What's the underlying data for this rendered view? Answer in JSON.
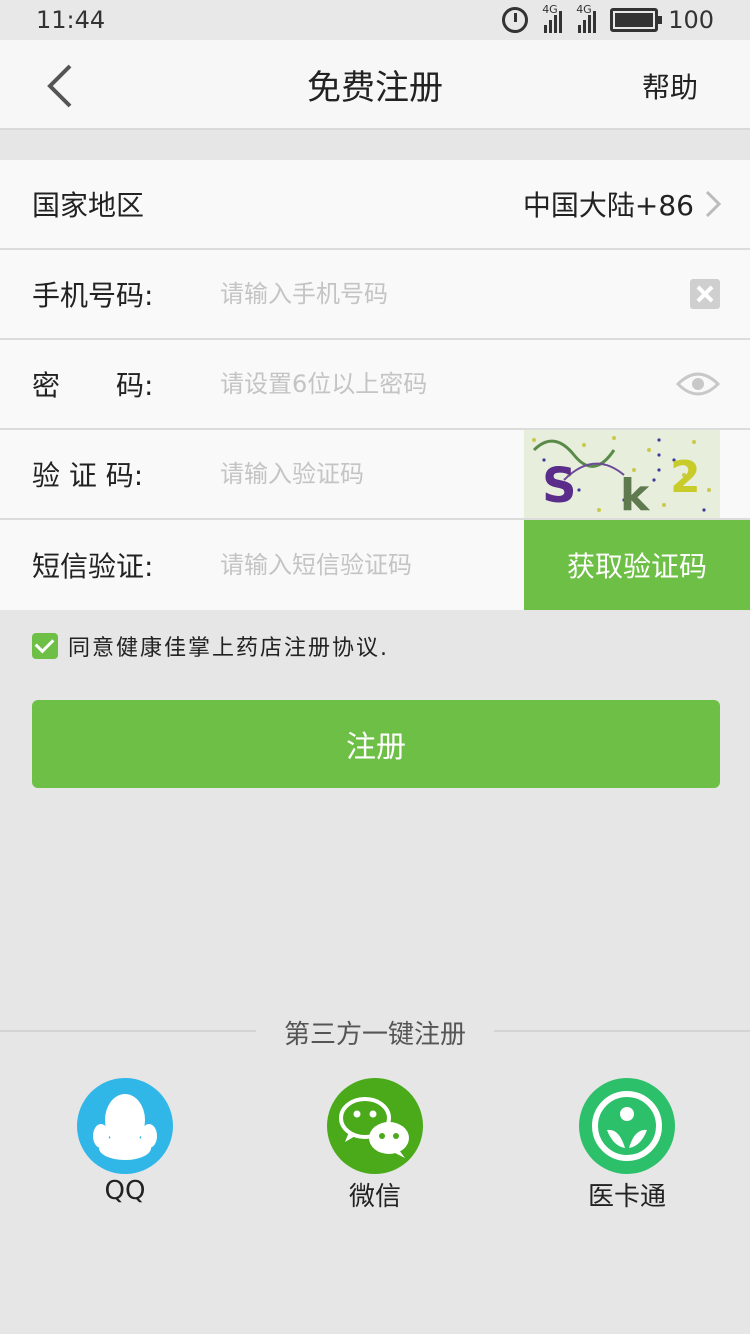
{
  "status_bar": {
    "time": "11:44",
    "signal1_label": "4G",
    "signal2_label": "4G",
    "battery": "100"
  },
  "header": {
    "title": "免费注册",
    "help": "帮助"
  },
  "form": {
    "region_label": "国家地区",
    "region_value": "中国大陆+86",
    "phone_label": "手机号码:",
    "phone_placeholder": "请输入手机号码",
    "password_label": "密　　码:",
    "password_placeholder": "请设置6位以上密码",
    "captcha_label": "验 证 码:",
    "captcha_placeholder": "请输入验证码",
    "captcha_text": [
      "S",
      "k",
      "2"
    ],
    "sms_label": "短信验证:",
    "sms_placeholder": "请输入短信验证码",
    "sms_button": "获取验证码"
  },
  "agreement": {
    "checked": true,
    "text": "同意健康佳掌上药店注册协议."
  },
  "register_button": "注册",
  "third_party": {
    "title": "第三方一键注册",
    "items": [
      {
        "name": "QQ",
        "icon": "qq-icon",
        "color": "#30b7e8"
      },
      {
        "name": "微信",
        "icon": "wechat-icon",
        "color": "#4aaa1a"
      },
      {
        "name": "医卡通",
        "icon": "yikatong-icon",
        "color": "#2dc06a"
      }
    ]
  },
  "colors": {
    "accent": "#6dbf45",
    "background": "#e6e6e6"
  }
}
